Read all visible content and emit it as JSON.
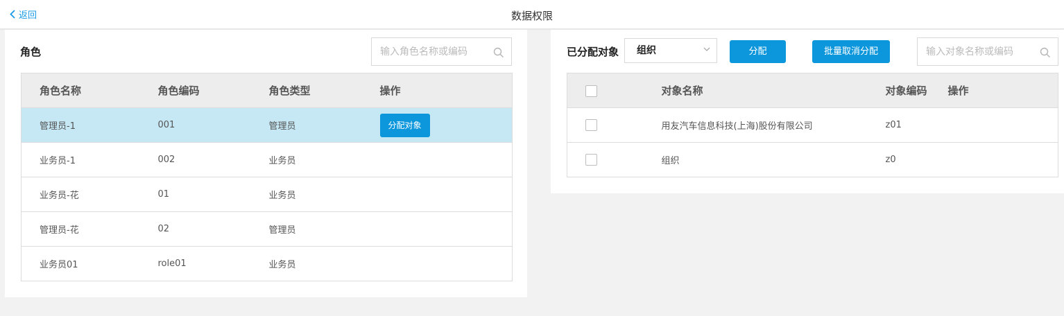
{
  "header": {
    "back_label": "返回",
    "title": "数据权限"
  },
  "roles": {
    "section_title": "角色",
    "search_placeholder": "输入角色名称或编码",
    "columns": [
      "角色名称",
      "角色编码",
      "角色类型",
      "操作"
    ],
    "rows": [
      {
        "name": "管理员-1",
        "code": "001",
        "type": "管理员",
        "action": "分配对象",
        "selected": true
      },
      {
        "name": "业务员-1",
        "code": "002",
        "type": "业务员",
        "action": ""
      },
      {
        "name": "业务员-花",
        "code": "01",
        "type": "业务员",
        "action": ""
      },
      {
        "name": "管理员-花",
        "code": "02",
        "type": "管理员",
        "action": ""
      },
      {
        "name": "业务员01",
        "code": "role01",
        "type": "业务员",
        "action": ""
      }
    ]
  },
  "assigned": {
    "section_title": "已分配对象",
    "type_select_value": "组织",
    "assign_label": "分配",
    "batch_unassign_label": "批量取消分配",
    "search_placeholder": "输入对象名称或编码",
    "columns": [
      "",
      "对象名称",
      "对象编码",
      "操作"
    ],
    "rows": [
      {
        "name": "用友汽车信息科技(上海)股份有限公司",
        "code": "z01"
      },
      {
        "name": "组织",
        "code": "z0"
      }
    ]
  },
  "colors": {
    "accent": "#0c97dd",
    "selected_row": "#c5e8f4",
    "header_bg": "#ededed",
    "page_bg": "#f2f2f2"
  }
}
